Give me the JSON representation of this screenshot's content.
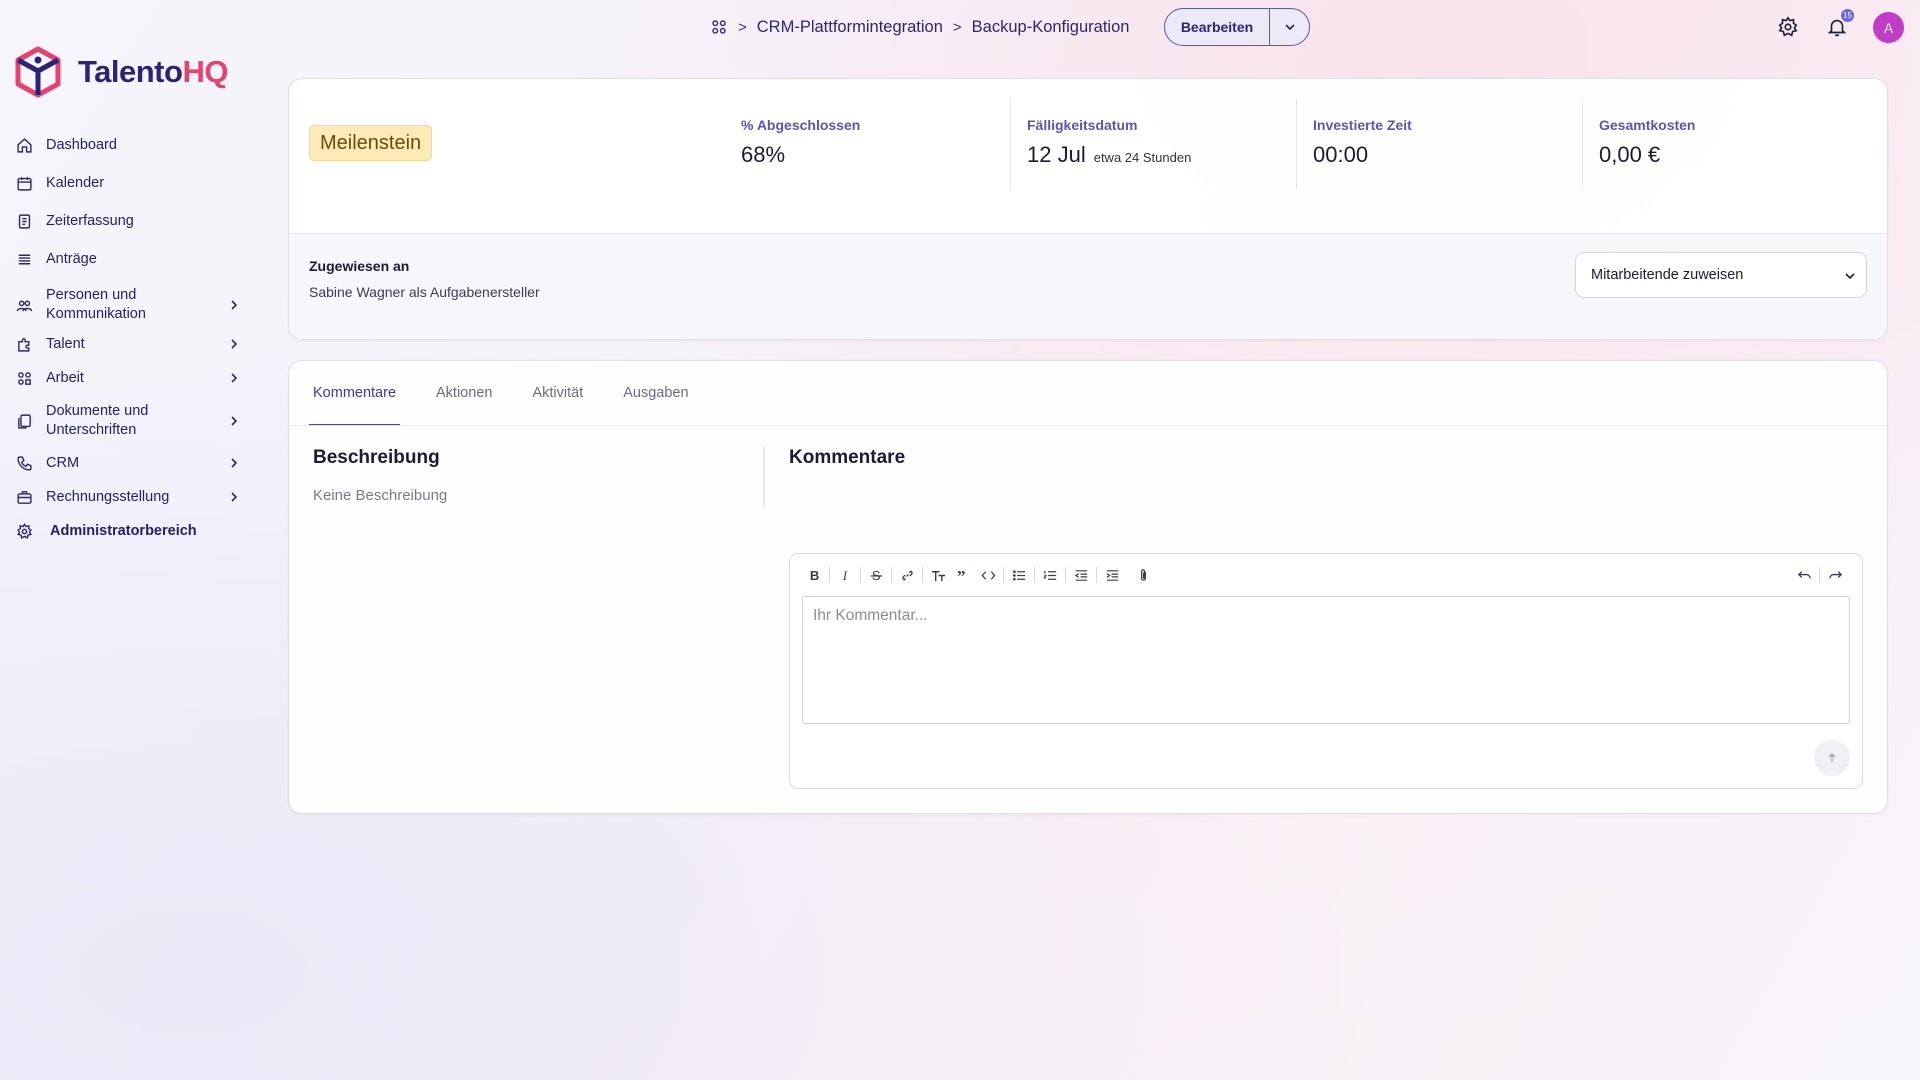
{
  "app": {
    "logo_part1": "Talento",
    "logo_part2": "HQ",
    "brand_color": "#2a2476",
    "accent_color": "#e5426d"
  },
  "sidebar": {
    "items": [
      {
        "label": "Dashboard",
        "icon": "home-icon"
      },
      {
        "label": "Kalender",
        "icon": "calendar-icon"
      },
      {
        "label": "Zeiterfassung",
        "icon": "timesheet-icon"
      },
      {
        "label": "Anträge",
        "icon": "list-icon"
      },
      {
        "label": "Personen und Kommunikation",
        "icon": "people-icon"
      },
      {
        "label": "Talent",
        "icon": "puzzle-icon"
      },
      {
        "label": "Arbeit",
        "icon": "grid-icon"
      },
      {
        "label": "Dokumente und Unterschriften",
        "icon": "documents-icon"
      },
      {
        "label": "CRM",
        "icon": "phone-icon"
      },
      {
        "label": "Rechnungsstellung",
        "icon": "briefcase-icon"
      },
      {
        "label": "Administratorbereich",
        "icon": "settings-icon"
      }
    ]
  },
  "header": {
    "breadcrumb": [
      "CRM-Plattformintegration",
      "Backup-Konfiguration"
    ],
    "edit_label": "Bearbeiten",
    "notification_count": "15",
    "avatar_initial": "A"
  },
  "task": {
    "type_badge": "Meilenstein",
    "stats": [
      {
        "label": "% Abgeschlossen",
        "value": "68%",
        "sub": ""
      },
      {
        "label": "Fälligkeitsdatum",
        "value": "12 Jul",
        "sub": "etwa 24 Stunden"
      },
      {
        "label": "Investierte Zeit",
        "value": "00:00",
        "sub": ""
      },
      {
        "label": "Gesamtkosten",
        "value": "0,00 €",
        "sub": ""
      }
    ],
    "assigned_label": "Zugewiesen an",
    "assigned_text": "Sabine Wagner als Aufgabenersteller",
    "assign_select": "Mitarbeitende zuweisen"
  },
  "tabs": [
    "Kommentare",
    "Aktionen",
    "Aktivität",
    "Ausgaben"
  ],
  "description": {
    "title": "Beschreibung",
    "text": "Keine Beschreibung"
  },
  "comments": {
    "title": "Kommentare",
    "placeholder": "Ihr Kommentar..."
  }
}
